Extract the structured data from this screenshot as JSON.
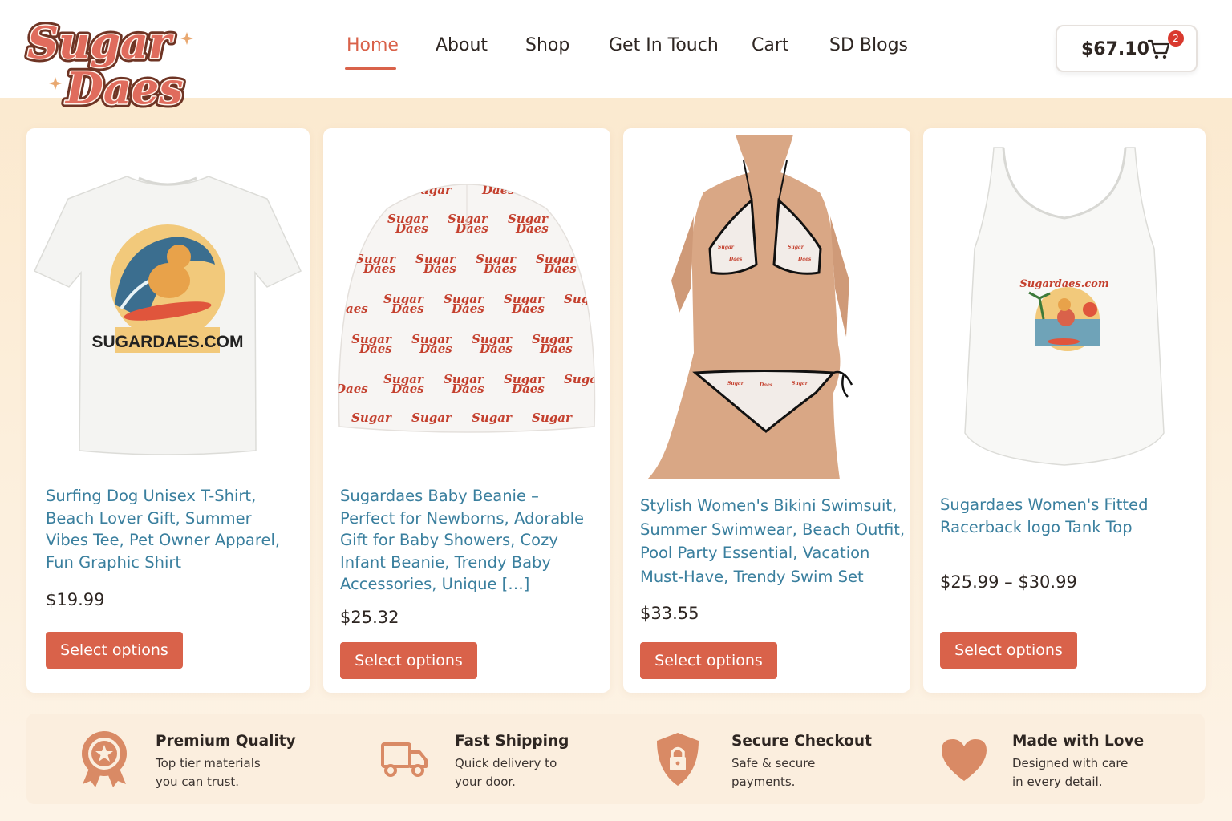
{
  "brand": {
    "logo_line1": "Sugar",
    "logo_line2": "Daes"
  },
  "nav": {
    "items": [
      "Home",
      "About",
      "Shop",
      "Get In Touch",
      "Cart",
      "SD Blogs"
    ],
    "active": "Home"
  },
  "cart": {
    "total": "$67.10",
    "count": "2"
  },
  "products": [
    {
      "title_lines": [
        "Surfing Dog Unisex T-Shirt,",
        "Beach Lover Gift, Summer",
        "Vibes Tee, Pet Owner Apparel,",
        "Fun Graphic Shirt"
      ],
      "price": "$19.99",
      "button": "Select options",
      "image_text": "SUGARDAES.COM"
    },
    {
      "title_lines": [
        "Sugardaes Baby Beanie –",
        "Perfect for Newborns, Adorable",
        "Gift for Baby Showers, Cozy",
        "Infant Beanie, Trendy Baby",
        "Accessories, Unique […]"
      ],
      "price": "$25.32",
      "button": "Select options",
      "image_text": "Sugar Daes"
    },
    {
      "title_lines": [
        "Stylish Women's Bikini Swimsuit,",
        "Summer Swimwear, Beach Outfit,",
        "Pool Party Essential, Vacation",
        "Must-Have, Trendy Swim Set"
      ],
      "price": "$33.55",
      "button": "Select options"
    },
    {
      "title_lines": [
        "Sugardaes Women's Fitted",
        "Racerback logo Tank Top"
      ],
      "price": "$25.99 – $30.99",
      "button": "Select options",
      "image_text": "Sugardaes.com"
    }
  ],
  "features": [
    {
      "icon": "award-ribbon-icon",
      "title": "Premium Quality",
      "desc_lines": [
        "Top tier materials",
        "you can trust."
      ]
    },
    {
      "icon": "delivery-truck-icon",
      "title": "Fast Shipping",
      "desc_lines": [
        "Quick delivery to",
        "your door."
      ]
    },
    {
      "icon": "shield-lock-icon",
      "title": "Secure Checkout",
      "desc_lines": [
        "Safe & secure",
        "payments."
      ]
    },
    {
      "icon": "heart-icon",
      "title": "Made with Love",
      "desc_lines": [
        "Designed with care",
        "in every detail."
      ]
    }
  ],
  "colors": {
    "accent": "#d9624a",
    "link": "#3a7f9e",
    "background": "#fbe8cc",
    "badge": "#d9392e",
    "feature_icon": "#d98a65"
  }
}
